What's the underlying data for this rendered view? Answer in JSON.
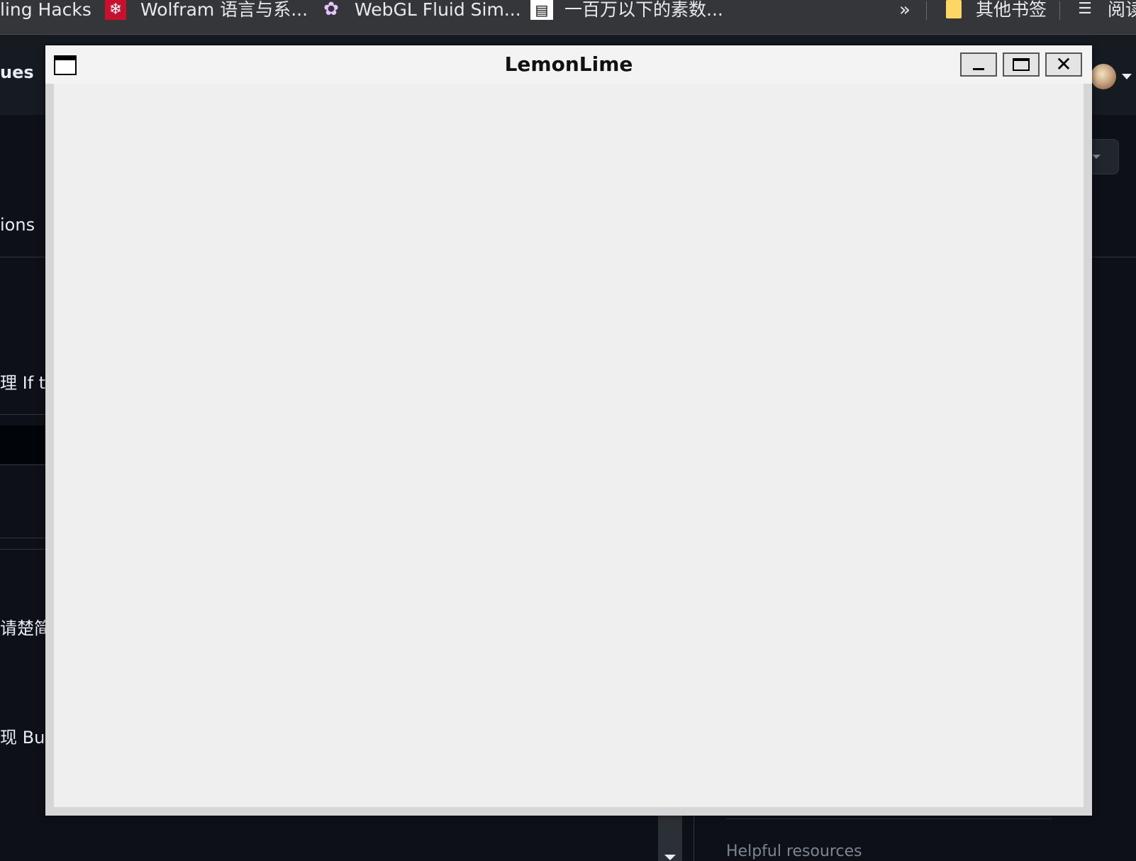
{
  "bookmarks": {
    "items": [
      {
        "label": "ling Hacks"
      },
      {
        "label": "Wolfram 语言与系...",
        "icon": "wolfram-icon"
      },
      {
        "label": "WebGL Fluid Sim...",
        "icon": "fluid-icon"
      },
      {
        "label": "一百万以下的素数...",
        "icon": "page-icon"
      }
    ],
    "more": "»",
    "folder": {
      "label": "其他书签",
      "icon": "folder-icon"
    },
    "reader": {
      "label": "阅读",
      "icon": "reading-list-icon"
    }
  },
  "background_page": {
    "header_text": "ues",
    "lines": [
      "ions",
      "理 If t",
      "请楚简",
      "现 Bug"
    ],
    "helpful_resources": "Helpful resources"
  },
  "window": {
    "title": "LemonLime",
    "close_glyph": "✕"
  },
  "colors": {
    "browser_chrome": "#35363a",
    "page_background": "#0d1117",
    "window_client": "#efefef",
    "window_titlebar": "#f3f3f3"
  }
}
